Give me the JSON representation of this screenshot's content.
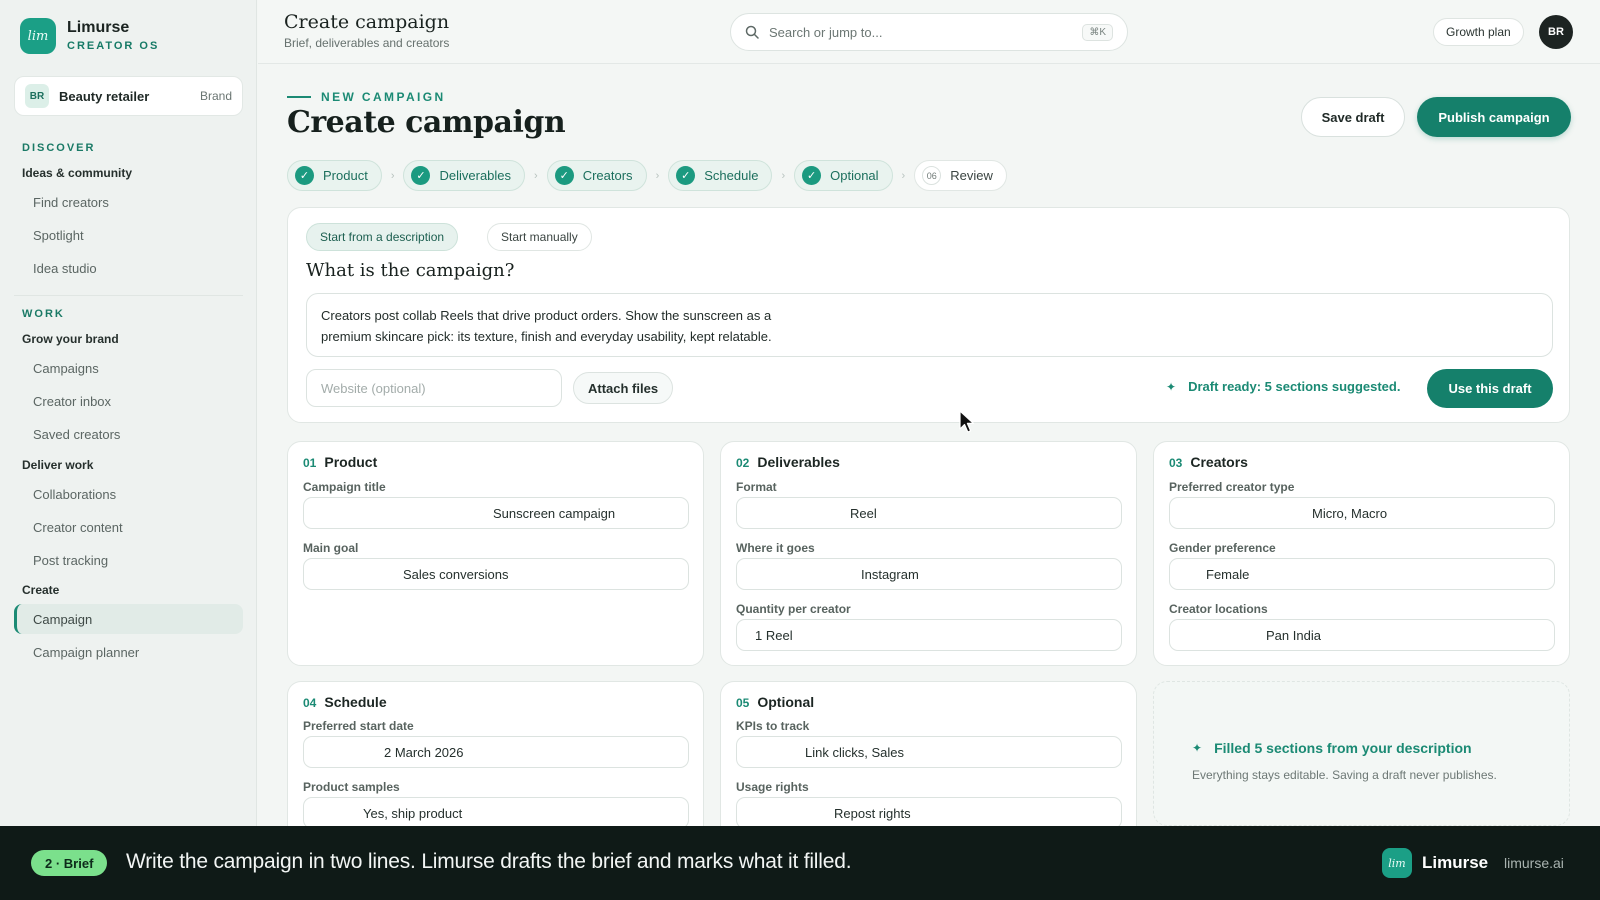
{
  "app": {
    "name": "Limurse",
    "tagline": "CREATOR OS",
    "logo_text": "lim"
  },
  "workspace": {
    "initials": "BR",
    "name": "Beauty retailer",
    "tag": "Brand"
  },
  "sidebar": {
    "discover_label": "DISCOVER",
    "discover_group": "Ideas & community",
    "discover_items": [
      "Find creators",
      "Spotlight",
      "Idea studio"
    ],
    "work_label": "WORK",
    "grow_group": "Grow your brand",
    "grow_items": [
      "Campaigns",
      "Creator inbox",
      "Saved creators"
    ],
    "deliver_group": "Deliver work",
    "deliver_items": [
      "Collaborations",
      "Creator content",
      "Post tracking"
    ],
    "create_group": "Create",
    "create_items": [
      "Campaign",
      "Campaign planner"
    ],
    "active_item": "Campaign"
  },
  "topbar": {
    "title": "Create campaign",
    "subtitle": "Brief, deliverables and creators",
    "search_placeholder": "Search or jump to...",
    "search_shortcut": "⌘K",
    "plan": "Growth plan",
    "user_initials": "BR"
  },
  "header": {
    "eyebrow": "NEW CAMPAIGN",
    "title": "Create campaign",
    "save_label": "Save draft",
    "publish_label": "Publish campaign"
  },
  "steps": [
    {
      "label": "Product",
      "done": true
    },
    {
      "label": "Deliverables",
      "done": true
    },
    {
      "label": "Creators",
      "done": true
    },
    {
      "label": "Schedule",
      "done": true
    },
    {
      "label": "Optional",
      "done": true
    },
    {
      "number": "06",
      "label": "Review",
      "done": false
    }
  ],
  "describe": {
    "tab_active": "Start from a description",
    "tab_idle": "Start manually",
    "question": "What is the campaign?",
    "text_line1": "Creators post collab Reels that drive product orders. Show the sunscreen as a",
    "text_line2": "premium skincare pick: its texture, finish and everyday usability, kept relatable.",
    "website_placeholder": "Website (optional)",
    "attach_label": "Attach files",
    "status": "Draft ready: 5 sections suggested.",
    "use_label": "Use this draft"
  },
  "sections": {
    "product": {
      "num": "01",
      "title": "Product",
      "campaign_title_label": "Campaign title",
      "campaign_title": "Sunscreen campaign",
      "goal_label": "Main goal",
      "goal": "Sales conversions"
    },
    "deliverables": {
      "num": "02",
      "title": "Deliverables",
      "format_label": "Format",
      "format": "Reel",
      "where_label": "Where it goes",
      "where": "Instagram",
      "qty_label": "Quantity per creator",
      "qty": "1 Reel"
    },
    "creators": {
      "num": "03",
      "title": "Creators",
      "type_label": "Preferred creator type",
      "type": "Micro, Macro",
      "gender_label": "Gender preference",
      "gender": "Female",
      "loc_label": "Creator locations",
      "loc": "Pan India"
    },
    "schedule": {
      "num": "04",
      "title": "Schedule",
      "start_label": "Preferred start date",
      "start": "2 March 2026",
      "samples_label": "Product samples",
      "samples": "Yes, ship product"
    },
    "optional": {
      "num": "05",
      "title": "Optional",
      "kpi_label": "KPIs to track",
      "kpi": "Link clicks, Sales",
      "rights_label": "Usage rights",
      "rights": "Repost rights"
    }
  },
  "filled": {
    "title": "Filled 5 sections from your description",
    "subtitle": "Everything stays editable. Saving a draft never publishes."
  },
  "footer": {
    "badge": "2 · Brief",
    "caption": "Write the campaign in two lines. Limurse drafts the brief and marks what it filled.",
    "brand": "Limurse",
    "url": "limurse.ai"
  },
  "colors": {
    "accent": "#15806b",
    "accent_light": "#e7f2ee",
    "badge": "#7be08c",
    "footer_bg": "#0f1a17"
  }
}
